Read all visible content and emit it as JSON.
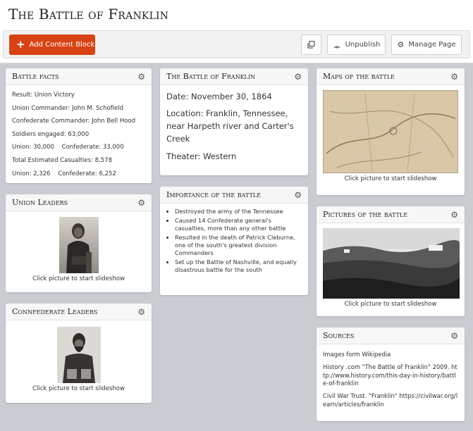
{
  "page": {
    "title": "The Battle of Franklin"
  },
  "toolbar": {
    "add_label": "Add Content Block",
    "unpublish_label": "Unpublish",
    "manage_label": "Manage Page",
    "accent": "#d84315"
  },
  "battle_facts": {
    "title": "Battle facts",
    "lines": [
      "Result: Union Victory",
      "Union Commander: John M. Schofield",
      "Confederate Commander: John Bell Hood",
      "Soldiers engaged: 63,000",
      "Union: 30,000    Confederate: 33,000",
      "Total Estimated Casualties: 8,578",
      "Union: 2,326    Confederate: 6,252"
    ]
  },
  "union_leaders": {
    "title": "Union Leaders",
    "caption": "Click picture to start slideshow"
  },
  "confederate_leaders": {
    "title": "Connfederate Leaders",
    "caption": "Click picture to start slideshow"
  },
  "overview": {
    "title": "The Battle of Franklin",
    "lines": [
      "Date: November 30, 1864",
      "Location: Franklin, Tennessee, near Harpeth river and Carter's Creek",
      "Theater: Western"
    ]
  },
  "importance": {
    "title": "Importance of the battle",
    "items": [
      "Destroyed the army of the Tennessee",
      "Caused 14 Confederate general's casualties, more than any other battle",
      "Resulted in the death of Patrick Cleburne, one of the south's greatest division Commanders",
      "Set up the Battle of Nashville, and equally disastrous battle for the south"
    ]
  },
  "maps": {
    "title": "Maps of the battle",
    "caption": "Click picture to start slideshow"
  },
  "pictures": {
    "title": "Pictures of the battle",
    "caption": "Click picture to start slideshow"
  },
  "sources": {
    "title": "Sources",
    "lines": [
      "Images form Wikipedia",
      "History .com \"The Battle of Franklin\" 2009. http://www.history.com/this-day-in-history/battle-of-franklin",
      "Civil War Trust. \"Franklin\" https://civilwar.org/learn/articles/franklin"
    ]
  },
  "icons": {
    "gear": "gear-icon",
    "plus": "plus-icon",
    "copy": "copy-icon",
    "signal": "unpublish-icon"
  }
}
